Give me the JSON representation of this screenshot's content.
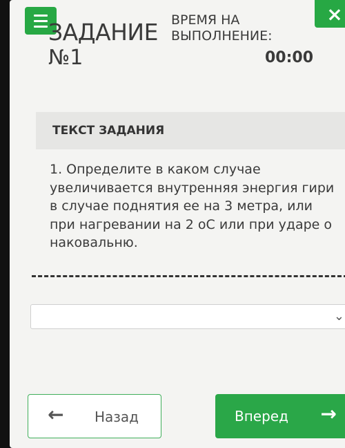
{
  "header": {
    "title_line1": "ЗАДАНИЕ",
    "title_line2": "№1",
    "time_label": "ВРЕМЯ НА ВЫПОЛНЕНИЕ:",
    "time_value": "00:00"
  },
  "icons": {
    "menu": "menu-icon",
    "close": "×",
    "chevron": "⌄",
    "back_arrow": "←",
    "next_arrow": "→"
  },
  "task": {
    "section_title": "ТЕКСТ ЗАДАНИЯ",
    "text": "1. Определите в каком случае увеличивается внутренняя энергия гири в случае поднятия ее на 3 метра, или при нагревании на 2 оС или при ударе о наковальню.",
    "answer_value": ""
  },
  "nav": {
    "back_label": "Назад",
    "next_label": "Вперед"
  },
  "colors": {
    "accent": "#27a844",
    "text": "#3a3a3a"
  }
}
